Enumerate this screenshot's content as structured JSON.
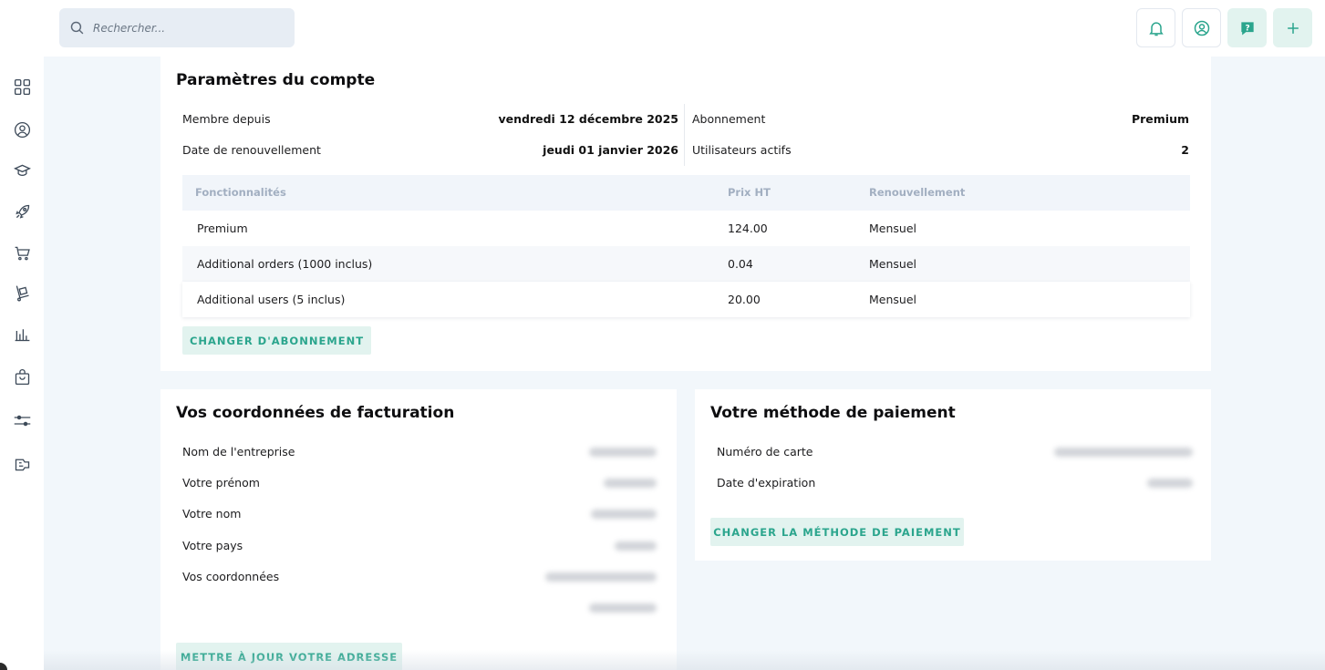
{
  "search": {
    "placeholder": "Rechercher..."
  },
  "icons": {
    "topbar": [
      "bell-icon",
      "user-circle-icon",
      "help-icon",
      "plus-icon"
    ],
    "sidebar": [
      "dashboard-icon",
      "user-icon",
      "academy-icon",
      "rocket-icon",
      "cart-icon",
      "package-icon",
      "chart-icon",
      "bag-icon",
      "settings-sliders-icon",
      "integrations-icon"
    ]
  },
  "colors": {
    "accent": "#2ba58d",
    "accent_bg": "#e2f3ef",
    "logo_orange": "#f08a24",
    "logo_red": "#e53d3d",
    "logo_yellow": "#f7b924"
  },
  "account": {
    "title": "Paramètres du compte",
    "member_since_label": "Membre depuis",
    "member_since_value": "vendredi 12 décembre 2025",
    "renewal_label": "Date de renouvellement",
    "renewal_value": "jeudi 01 janvier 2026",
    "subscription_label": "Abonnement",
    "subscription_value": "Premium",
    "active_users_label": "Utilisateurs actifs",
    "active_users_value": "2",
    "features_table": {
      "headers": [
        "Fonctionnalités",
        "Prix HT",
        "Renouvellement"
      ],
      "rows": [
        [
          "Premium",
          "124.00",
          "Mensuel"
        ],
        [
          "Additional orders (1000 inclus)",
          "0.04",
          "Mensuel"
        ],
        [
          "Additional users (5 inclus)",
          "20.00",
          "Mensuel"
        ]
      ]
    },
    "change_subscription_button": "CHANGER D'ABONNEMENT"
  },
  "billing": {
    "title": "Vos coordonnées de facturation",
    "fields": [
      "Nom de l'entreprise",
      "Votre prénom",
      "Votre nom",
      "Votre pays",
      "Vos coordonnées"
    ],
    "update_button": "METTRE À JOUR VOTRE ADRESSE"
  },
  "payment": {
    "title": "Votre méthode de paiement",
    "fields": [
      "Numéro de carte",
      "Date d'expiration"
    ],
    "change_button": "CHANGER LA MÉTHODE DE PAIEMENT"
  }
}
